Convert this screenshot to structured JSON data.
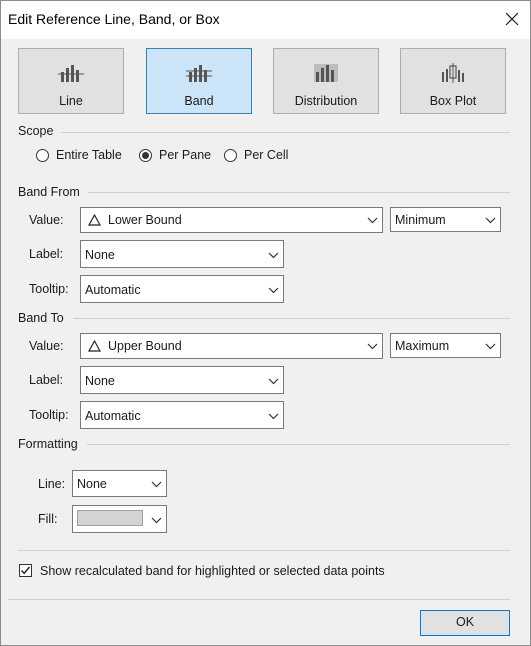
{
  "window": {
    "title": "Edit Reference Line, Band, or Box"
  },
  "types": [
    {
      "label": "Line"
    },
    {
      "label": "Band"
    },
    {
      "label": "Distribution"
    },
    {
      "label": "Box Plot"
    }
  ],
  "scope": {
    "heading": "Scope",
    "options": [
      "Entire Table",
      "Per Pane",
      "Per Cell"
    ],
    "selected": "Per Pane"
  },
  "band_from": {
    "heading": "Band From",
    "value_label": "Value:",
    "value": "Lower Bound",
    "aggregation": "Minimum",
    "label_label": "Label:",
    "label": "None",
    "tooltip_label": "Tooltip:",
    "tooltip": "Automatic"
  },
  "band_to": {
    "heading": "Band To",
    "value_label": "Value:",
    "value": "Upper Bound",
    "aggregation": "Maximum",
    "label_label": "Label:",
    "label": "None",
    "tooltip_label": "Tooltip:",
    "tooltip": "Automatic"
  },
  "formatting": {
    "heading": "Formatting",
    "line_label": "Line:",
    "line": "None",
    "fill_label": "Fill:",
    "fill_color": "#d3d3d3"
  },
  "recalc": {
    "label": "Show recalculated band for highlighted or selected data points",
    "checked": true
  },
  "footer": {
    "ok": "OK"
  }
}
